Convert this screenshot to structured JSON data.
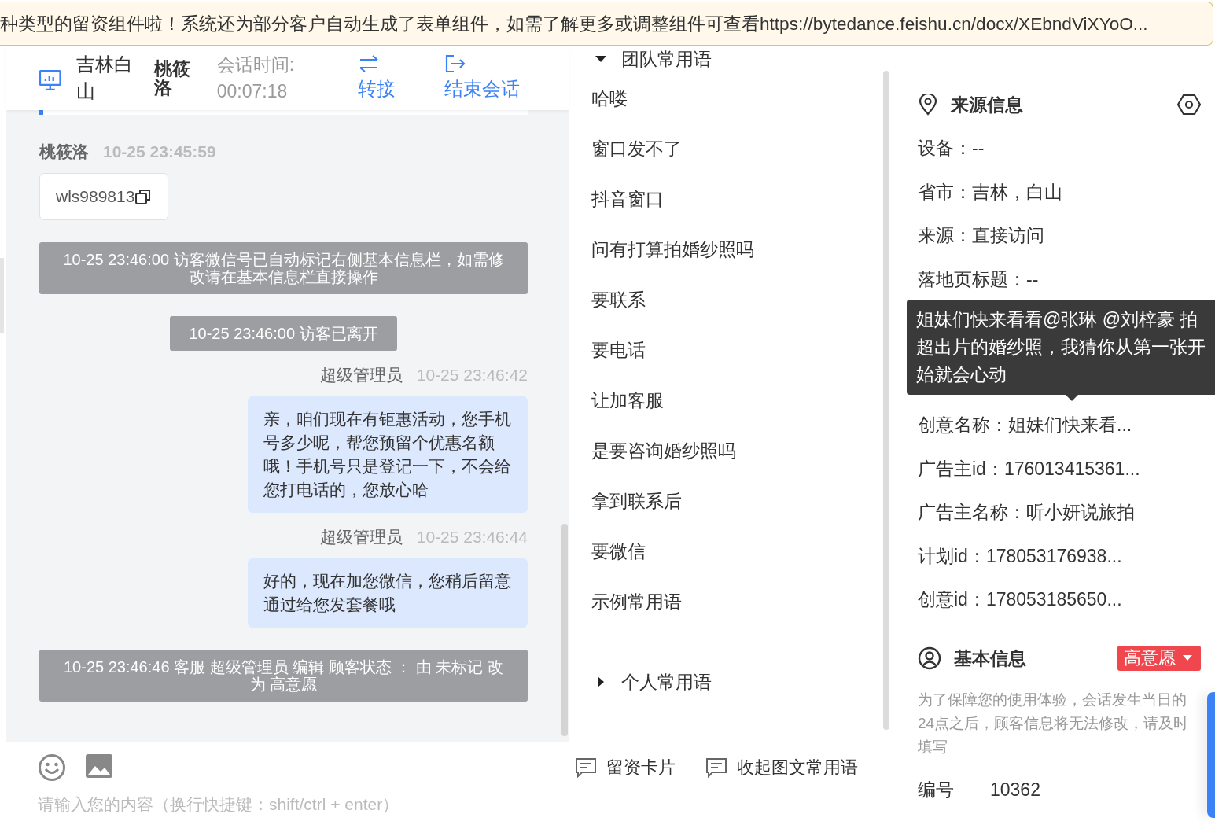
{
  "banner": {
    "text": "种类型的留资组件啦！系统还为部分客户自动生成了表单组件，如需了解更多或调整组件可查看https://bytedance.feishu.cn/docx/XEbndViXYoO..."
  },
  "session": {
    "location": "吉林白山",
    "visitor": "桃筱洛",
    "time_label": "会话时间:",
    "time_value": "00:07:18",
    "actions": [
      {
        "kind": "transfer",
        "label": "转接"
      },
      {
        "kind": "end",
        "label": "结束会话"
      }
    ]
  },
  "messages": [
    {
      "kind": "visitor",
      "sender": "桃筱洛",
      "time": "10-25 23:45:59",
      "card": "wls989813"
    },
    {
      "kind": "system",
      "text": "10-25 23:46:00 访客微信号已自动标记右侧基本信息栏，如需修改请在基本信息栏直接操作"
    },
    {
      "kind": "system",
      "text": "10-25 23:46:00 访客已离开"
    },
    {
      "kind": "agent",
      "sender": "超级管理员",
      "time": "10-25 23:46:42",
      "text": "亲，咱们现在有钜惠活动，您手机号多少呢，帮您预留个优惠名额哦！手机号只是登记一下，不会给您打电话的，您放心哈"
    },
    {
      "kind": "agent",
      "sender": "超级管理员",
      "time": "10-25 23:46:44",
      "text": "好的，现在加您微信，您稍后留意通过给您发套餐哦"
    },
    {
      "kind": "system",
      "text": "10-25 23:46:46 客服 超级管理员 编辑 顾客状态 ： 由 未标记 改为 高意愿"
    }
  ],
  "phrases": [
    {
      "label": "团队常用语",
      "expanded": true,
      "items": [
        "哈喽",
        "窗口发不了",
        "抖音窗口",
        "问有打算拍婚纱照吗",
        "要联系",
        "要电话",
        "让加客服",
        "是要咨询婚纱照吗",
        "拿到联系后",
        "要微信",
        "示例常用语"
      ]
    },
    {
      "label": "个人常用语",
      "expanded": false
    }
  ],
  "composer": {
    "tools": [
      {
        "kind": "emoji"
      },
      {
        "kind": "image"
      }
    ],
    "actions": [
      "留资卡片",
      "收起图文常用语"
    ],
    "placeholder": "请输入您的内容（换行快捷键：shift/ctrl + enter）"
  },
  "source_info": {
    "title": "来源信息",
    "rows": [
      "设备：--",
      "省市：吉林，白山",
      "来源：直接访问",
      "落地页标题：--",
      "创意名称：姐妹们快来看...",
      "广告主id：176013415361...",
      "广告主名称：听小妍说旅拍",
      "计划id：178053176938...",
      "创意id：178053185650..."
    ],
    "tooltip": {
      "lines": [
        "姐妹们快来看看@张琳 @刘梓豪 拍",
        "超出片的婚纱照，我猜你从第一张开",
        "始就会心动"
      ]
    }
  },
  "basic_info": {
    "title": "基本信息",
    "status": {
      "label": "高意愿"
    },
    "note": "为了保障您的使用体验，会话发生当日的24点之后，顾客信息将无法修改，请及时填写",
    "fields": [
      {
        "label": "编号",
        "value": "10362"
      }
    ]
  }
}
